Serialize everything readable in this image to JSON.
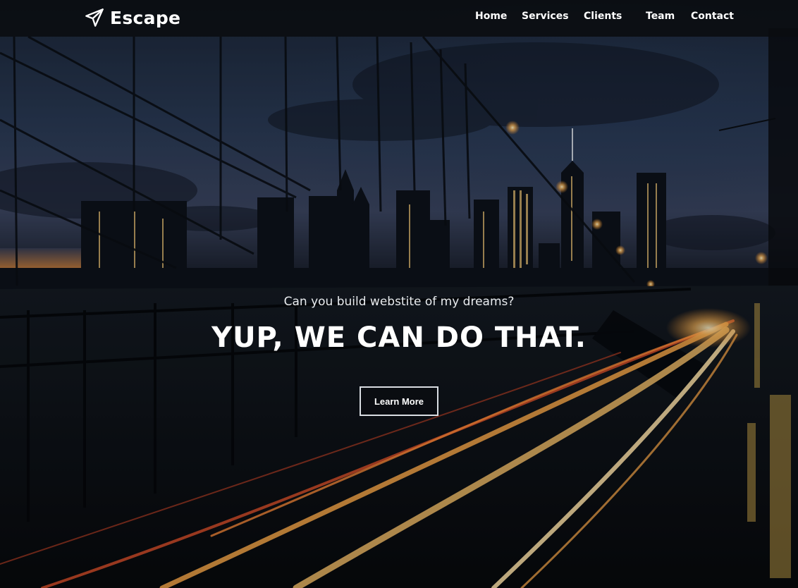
{
  "navbar": {
    "brand": {
      "name": "Escape",
      "icon": "paper-plane-icon"
    },
    "links": [
      {
        "label": "Home"
      },
      {
        "label": "Services"
      },
      {
        "label": "Clients"
      },
      {
        "label": "Team"
      },
      {
        "label": "Contact"
      }
    ]
  },
  "hero": {
    "background_image": "night city skyline seen through suspension bridge cables with light trails",
    "tagline": "Can you build webstite of my dreams?",
    "headline": "YUP, WE CAN DO THAT.",
    "cta_label": "Learn More"
  },
  "colors": {
    "navbar_bg": "#0a0c10",
    "text": "#ffffff",
    "button_border": "#d9dde2",
    "light_trail": "#f2a347"
  }
}
